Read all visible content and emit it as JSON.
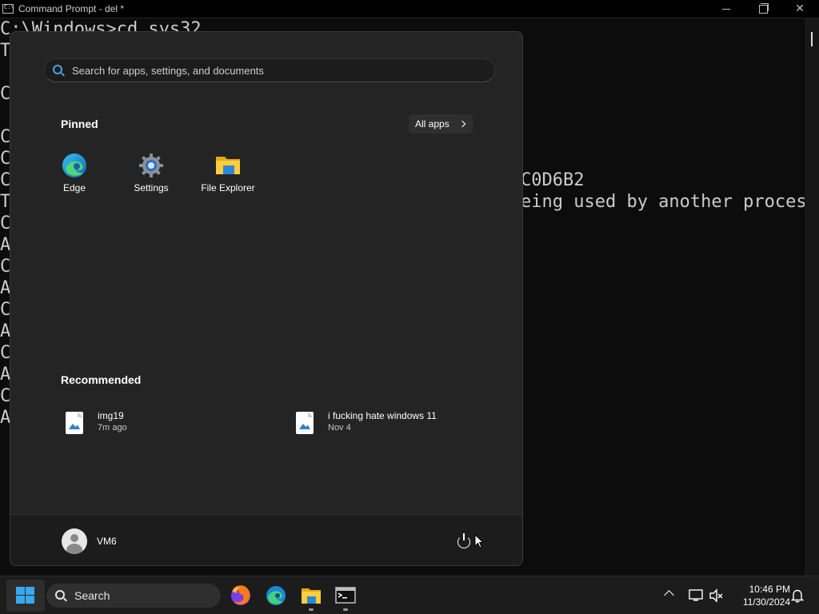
{
  "window": {
    "title": "Command Prompt - del  *",
    "controls": [
      "minimize",
      "maximize",
      "close"
    ]
  },
  "console": {
    "lines": [
      "C:\\Windows>cd sys32",
      "T",
      "",
      "C",
      "",
      "C",
      "C",
      "C",
      "T",
      "C",
      "A",
      "C",
      "A",
      "C",
      "A",
      "C",
      "A",
      "C",
      "A"
    ],
    "visible_fragments": [
      "C0D6B2",
      "eing used by another process"
    ]
  },
  "start_menu": {
    "search_placeholder": "Search for apps, settings, and documents",
    "pinned_title": "Pinned",
    "all_apps_label": "All apps",
    "pinned": [
      {
        "label": "Edge",
        "icon": "edge-icon"
      },
      {
        "label": "Settings",
        "icon": "settings-gear-icon"
      },
      {
        "label": "File Explorer",
        "icon": "folder-icon"
      }
    ],
    "recommended_title": "Recommended",
    "recommended": [
      {
        "name": "img19",
        "time": "7m ago"
      },
      {
        "name": "i fucking hate windows 11",
        "time": "Nov 4"
      }
    ],
    "user_name": "VM6"
  },
  "taskbar": {
    "search_label": "Search",
    "apps": [
      "firefox-icon",
      "edge-icon",
      "file-explorer-icon",
      "terminal-icon"
    ],
    "time": "10:46 PM",
    "date": "11/30/2024"
  },
  "colors": {
    "accent": "#3aa7ef",
    "start_bg": "#242424",
    "taskbar_bg": "#1c1c1c",
    "console_bg": "#0c0c0c"
  }
}
